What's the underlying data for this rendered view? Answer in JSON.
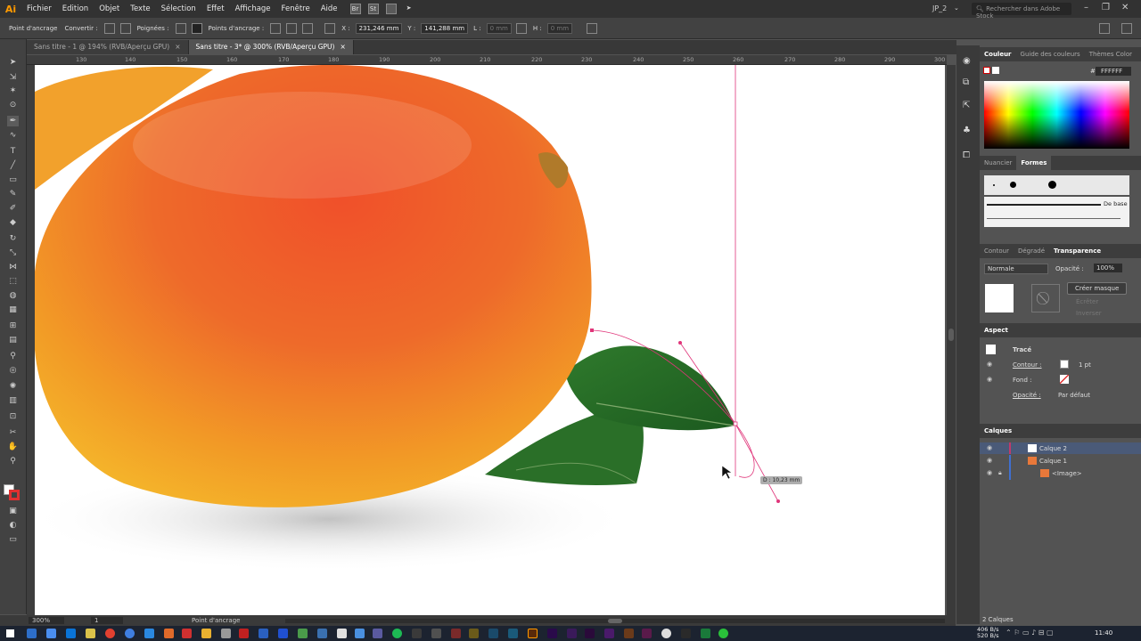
{
  "app": {
    "logo": "Ai"
  },
  "menu": [
    "Fichier",
    "Edition",
    "Objet",
    "Texte",
    "Sélection",
    "Effet",
    "Affichage",
    "Fenêtre",
    "Aide"
  ],
  "menu_badges": [
    "Br",
    "St"
  ],
  "workspace": "JP_2",
  "stock_search_placeholder": "Rechercher dans Adobe Stock",
  "control": {
    "anchor_label": "Point d'ancrage",
    "convert_label": "Convertir :",
    "handles_label": "Poignées :",
    "anchors_label": "Points d'ancrage :",
    "x_label": "X :",
    "x_value": "231,246 mm",
    "y_label": "Y :",
    "y_value": "141,288 mm",
    "w_label": "L :",
    "w_value": "0 mm",
    "h_label": "H :",
    "h_value": "0 mm"
  },
  "tabs": [
    {
      "label": "Sans titre - 1 @ 194% (RVB/Aperçu GPU)",
      "close": "×"
    },
    {
      "label": "Sans titre - 3* @ 300% (RVB/Aperçu GPU)",
      "close": "×"
    }
  ],
  "ruler_ticks": [
    "130",
    "140",
    "150",
    "160",
    "170",
    "180",
    "190",
    "200",
    "210",
    "220",
    "230",
    "240",
    "250",
    "260",
    "270",
    "280",
    "290",
    "300"
  ],
  "canvas": {
    "distance_readout": "D : 10,23 mm"
  },
  "status": {
    "zoom": "300%",
    "artboard": "1",
    "tool": "Point d'ancrage"
  },
  "panel_color": {
    "tabs": [
      "Couleur",
      "Guide des couleurs",
      "Thèmes Color"
    ],
    "hex_label": "#",
    "hex_value": "FFFFFF"
  },
  "panel_brushes": {
    "tabs": [
      "Nuancier",
      "Formes"
    ],
    "default_label": "De base"
  },
  "panel_transparency": {
    "tabs": [
      "Contour",
      "Dégradé",
      "Transparence"
    ],
    "blend_mode": "Normale",
    "opacity_label": "Opacité :",
    "opacity_value": "100%",
    "mask_button": "Créer masque",
    "clip_label": "Écrêter",
    "invert_label": "Inverser"
  },
  "panel_appearance": {
    "title": "Aspect",
    "object": "Tracé",
    "stroke_label": "Contour :",
    "stroke_value": "1 pt",
    "fill_label": "Fond :",
    "opacity_label": "Opacité :",
    "opacity_value": "Par défaut"
  },
  "panel_layers": {
    "title": "Calques",
    "layers": [
      {
        "name": "Calque 2"
      },
      {
        "name": "Calque 1"
      },
      {
        "name": "<Image>"
      }
    ],
    "footer": "2 Calques"
  },
  "taskbar": {
    "net_up": "406 B/s",
    "net_down": "520 B/s",
    "clock": "11:40"
  },
  "colors": {
    "accent": "#ff9a00",
    "path": "#e0357a",
    "layer2": "#c03a6a",
    "layer1": "#3f6fd0"
  }
}
